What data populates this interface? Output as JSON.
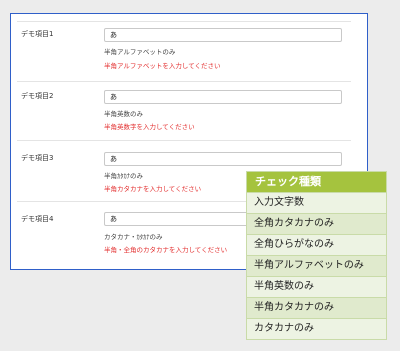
{
  "rows": [
    {
      "label": "デモ項目1",
      "value": "あ",
      "hint": "半角アルファベットのみ",
      "error": "半角アルファベットを入力してください"
    },
    {
      "label": "デモ項目2",
      "value": "あ",
      "hint": "半角英数のみ",
      "error": "半角英数字を入力してください"
    },
    {
      "label": "デモ項目3",
      "value": "あ",
      "hint": "半角ｶﾀｶﾅのみ",
      "error": "半角カタカナを入力してください"
    },
    {
      "label": "デモ項目4",
      "value": "あ",
      "hint": "カタカナ・ｶﾀｶﾅのみ",
      "error": "半角・全角のカタカナを入力してください"
    }
  ],
  "check_panel": {
    "title": "チェック種類",
    "items": [
      "入力文字数",
      "全角カタカナのみ",
      "全角ひらがなのみ",
      "半角アルファベットのみ",
      "半角英数のみ",
      "半角カタカナのみ",
      "カタカナのみ"
    ]
  },
  "colors": {
    "accent_border": "#2f5fc9",
    "error_text": "#e32f2f",
    "panel_header": "#a5c33e"
  }
}
